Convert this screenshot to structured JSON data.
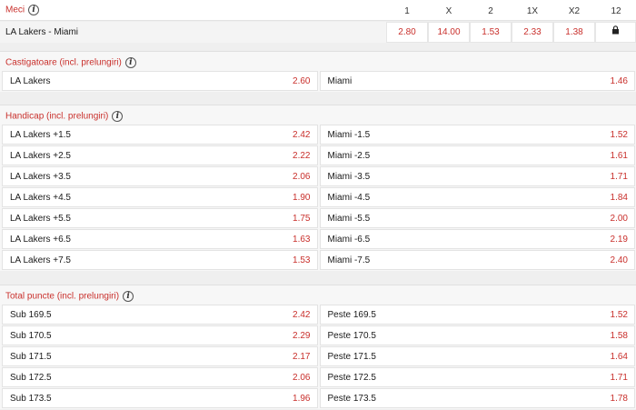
{
  "match": {
    "title": "Meci",
    "columns": [
      "1",
      "X",
      "2",
      "1X",
      "X2",
      "12"
    ],
    "name": "LA Lakers - Miami",
    "odds": [
      "2.80",
      "14.00",
      "1.53",
      "2.33",
      "1.38"
    ]
  },
  "markets": [
    {
      "title": "Castigatoare (incl. prelungiri)",
      "rows": [
        [
          {
            "label": "LA Lakers",
            "odd": "2.60"
          },
          {
            "label": "Miami",
            "odd": "1.46"
          }
        ]
      ]
    },
    {
      "title": "Handicap (incl. prelungiri)",
      "rows": [
        [
          {
            "label": "LA Lakers +1.5",
            "odd": "2.42"
          },
          {
            "label": "Miami -1.5",
            "odd": "1.52"
          }
        ],
        [
          {
            "label": "LA Lakers +2.5",
            "odd": "2.22"
          },
          {
            "label": "Miami -2.5",
            "odd": "1.61"
          }
        ],
        [
          {
            "label": "LA Lakers +3.5",
            "odd": "2.06"
          },
          {
            "label": "Miami -3.5",
            "odd": "1.71"
          }
        ],
        [
          {
            "label": "LA Lakers +4.5",
            "odd": "1.90"
          },
          {
            "label": "Miami -4.5",
            "odd": "1.84"
          }
        ],
        [
          {
            "label": "LA Lakers +5.5",
            "odd": "1.75"
          },
          {
            "label": "Miami -5.5",
            "odd": "2.00"
          }
        ],
        [
          {
            "label": "LA Lakers +6.5",
            "odd": "1.63"
          },
          {
            "label": "Miami -6.5",
            "odd": "2.19"
          }
        ],
        [
          {
            "label": "LA Lakers +7.5",
            "odd": "1.53"
          },
          {
            "label": "Miami -7.5",
            "odd": "2.40"
          }
        ]
      ]
    },
    {
      "title": "Total puncte (incl. prelungiri)",
      "rows": [
        [
          {
            "label": "Sub 169.5",
            "odd": "2.42"
          },
          {
            "label": "Peste 169.5",
            "odd": "1.52"
          }
        ],
        [
          {
            "label": "Sub 170.5",
            "odd": "2.29"
          },
          {
            "label": "Peste 170.5",
            "odd": "1.58"
          }
        ],
        [
          {
            "label": "Sub 171.5",
            "odd": "2.17"
          },
          {
            "label": "Peste 171.5",
            "odd": "1.64"
          }
        ],
        [
          {
            "label": "Sub 172.5",
            "odd": "2.06"
          },
          {
            "label": "Peste 172.5",
            "odd": "1.71"
          }
        ],
        [
          {
            "label": "Sub 173.5",
            "odd": "1.96"
          },
          {
            "label": "Peste 173.5",
            "odd": "1.78"
          }
        ]
      ]
    }
  ],
  "icons": {
    "info": "info-icon",
    "lock": "lock-icon"
  },
  "colors": {
    "accent": "#c9302c"
  }
}
